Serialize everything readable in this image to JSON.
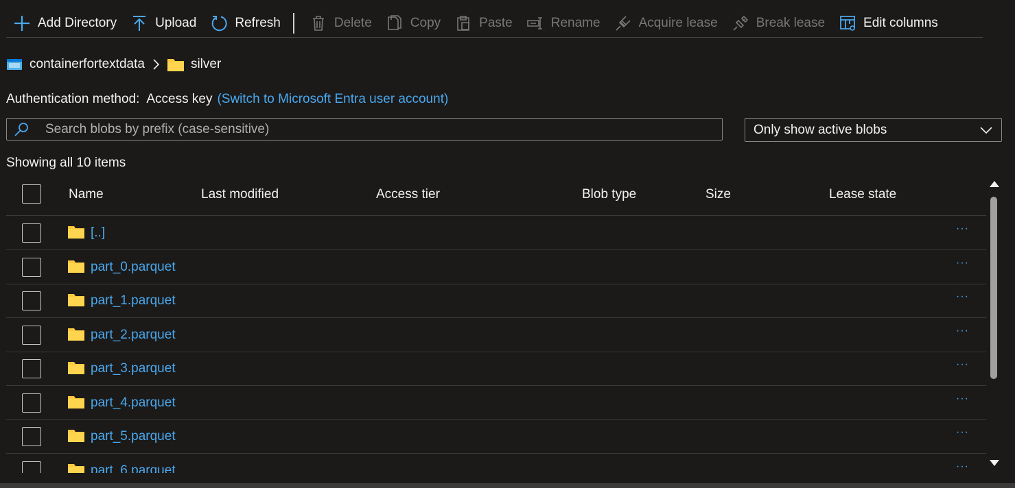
{
  "toolbar": {
    "add_directory": "Add Directory",
    "upload": "Upload",
    "refresh": "Refresh",
    "delete": "Delete",
    "copy": "Copy",
    "paste": "Paste",
    "rename": "Rename",
    "acquire_lease": "Acquire lease",
    "break_lease": "Break lease",
    "edit_columns": "Edit columns"
  },
  "breadcrumb": {
    "container": "containerfortextdata",
    "folder": "silver"
  },
  "auth": {
    "label": "Authentication method:",
    "value": "Access key",
    "switch_link": "(Switch to Microsoft Entra user account)"
  },
  "search": {
    "placeholder": "Search blobs by prefix (case-sensitive)"
  },
  "filter": {
    "selected": "Only show active blobs"
  },
  "status": {
    "count_text": "Showing all 10 items"
  },
  "table": {
    "columns": {
      "name": "Name",
      "last_modified": "Last modified",
      "access_tier": "Access tier",
      "blob_type": "Blob type",
      "size": "Size",
      "lease_state": "Lease state"
    },
    "rows": [
      {
        "name": "[..]"
      },
      {
        "name": "part_0.parquet"
      },
      {
        "name": "part_1.parquet"
      },
      {
        "name": "part_2.parquet"
      },
      {
        "name": "part_3.parquet"
      },
      {
        "name": "part_4.parquet"
      },
      {
        "name": "part_5.parquet"
      },
      {
        "name": "part_6.parquet"
      }
    ],
    "more_label": "···"
  },
  "colors": {
    "background": "#1b1a19",
    "link": "#4aa8ef",
    "folder": "#ffc83d",
    "disabled": "#797775"
  }
}
